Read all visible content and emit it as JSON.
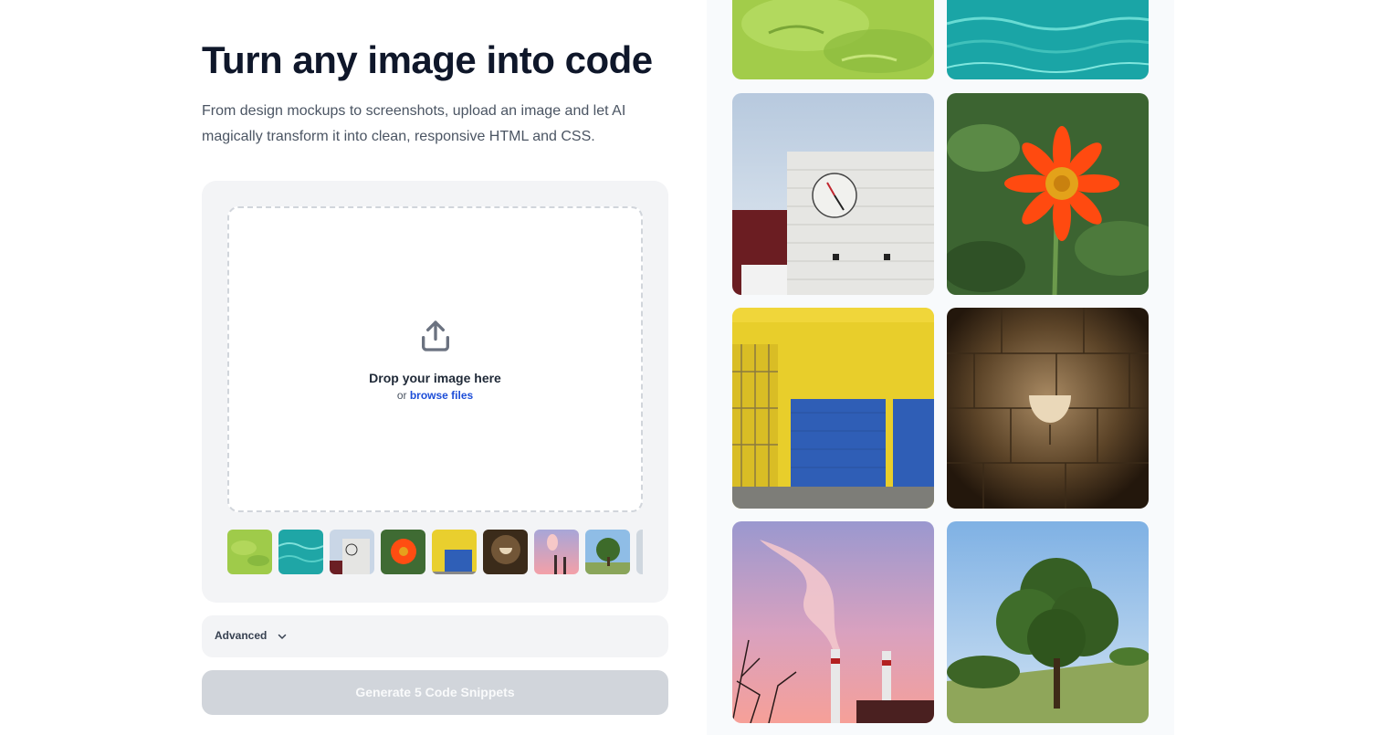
{
  "hero": {
    "title": "Turn any image into code",
    "subtitle": "From design mockups to screenshots, upload an image and let AI magically transform it into clean, responsive HTML and CSS."
  },
  "upload": {
    "drop_title": "Drop your image here",
    "or_text": "or",
    "browse_label": "browse files",
    "icon": "upload-icon"
  },
  "sample_thumbnails": [
    "green-water-icon",
    "turquoise-water-icon",
    "clock-building-icon",
    "orange-flower-icon",
    "yellow-wall-garage-icon",
    "wall-lamp-icon",
    "smokestack-sunset-icon",
    "tree-icon",
    "partial-thumbnail-icon"
  ],
  "advanced": {
    "label": "Advanced",
    "icon": "chevron-down-icon"
  },
  "generate": {
    "label": "Generate 5 Code Snippets"
  },
  "gallery": [
    "green-water-photo",
    "turquoise-water-photo",
    "clock-building-photo",
    "orange-flower-photo",
    "yellow-wall-garage-photo",
    "wall-lamp-photo",
    "smokestack-sunset-photo",
    "tree-photo"
  ],
  "colors": {
    "link": "#1d4ed8",
    "button_disabled": "#d1d5db",
    "panel": "#f3f4f6"
  }
}
